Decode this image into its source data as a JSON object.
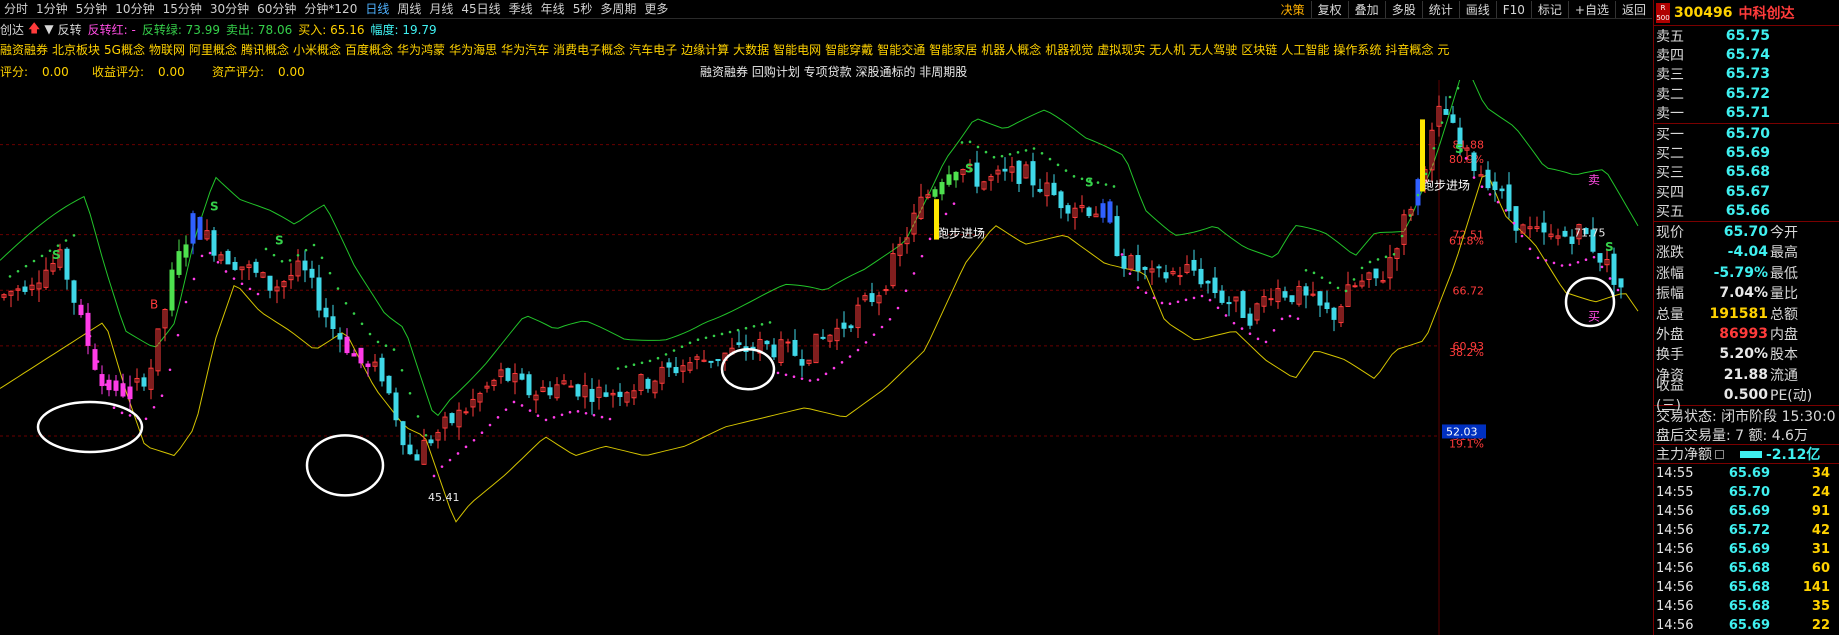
{
  "toolbar": {
    "periods": [
      "分时",
      "1分钟",
      "5分钟",
      "10分钟",
      "15分钟",
      "30分钟",
      "60分钟",
      "分钟*120",
      "日线",
      "周线",
      "月线",
      "45日线",
      "季线",
      "年线",
      "5秒",
      "多周期",
      "更多"
    ],
    "active_period": "日线",
    "tools": [
      "决策",
      "复权",
      "叠加",
      "多股",
      "统计",
      "画线",
      "F10",
      "标记",
      "+自选",
      "返回"
    ]
  },
  "indicator": {
    "name": "创达",
    "up_arrow_icon": "arrow-up-icon",
    "down_arrow_icon": "triangle-down-icon",
    "flip_label": "反转",
    "items": [
      {
        "text": "反转红: -",
        "color": "#ff4de3"
      },
      {
        "text": "反转绿: 73.99",
        "color": "#35d04a"
      },
      {
        "text": "卖出: 78.06",
        "color": "#35d04a"
      },
      {
        "text": "买入: 65.16",
        "color": "#ffd200"
      },
      {
        "text": "幅度: 19.79",
        "color": "#3ff0f0"
      }
    ]
  },
  "sectors": [
    "融资融券",
    "北京板块",
    "5G概念",
    "物联网",
    "阿里概念",
    "腾讯概念",
    "小米概念",
    "百度概念",
    "华为鸿蒙",
    "华为海思",
    "华为汽车",
    "消费电子概念",
    "汽车电子",
    "边缘计算",
    "大数据",
    "智能电网",
    "智能穿戴",
    "智能交通",
    "智能家居",
    "机器人概念",
    "机器视觉",
    "虚拟现实",
    "无人机",
    "无人驾驶",
    "区块链",
    "人工智能",
    "操作系统",
    "抖音概念",
    "元"
  ],
  "scores": [
    {
      "label": "评分:",
      "value": "0.00"
    },
    {
      "label": "收益评分:",
      "value": "0.00"
    },
    {
      "label": "资产评分:",
      "value": "0.00"
    }
  ],
  "note": "融资融券 回购计划 专项贷款 深股通标的 非周期股",
  "chart_data": {
    "type": "candlestick",
    "price_labels": [
      {
        "text": "81.88",
        "value": 81.88,
        "color": "#ff3b3b"
      },
      {
        "text": "80.9%",
        "value": 80.4,
        "color": "#ff3b3b"
      },
      {
        "text": "72.51",
        "value": 72.51,
        "color": "#ff3b3b"
      },
      {
        "text": "61.8%",
        "value": 71.9,
        "color": "#ff3b3b"
      },
      {
        "text": "66.72",
        "value": 66.72,
        "color": "#ff3b3b"
      },
      {
        "text": "60.93",
        "value": 60.93,
        "color": "#ff3b3b"
      },
      {
        "text": "38.2%",
        "value": 60.3,
        "color": "#ff3b3b"
      },
      {
        "text": "51.56",
        "value": 51.56,
        "color": "#ff3b3b"
      },
      {
        "text": "19.1%",
        "value": 50.8,
        "color": "#ff3b3b"
      }
    ],
    "highlight_price": "52.03",
    "highlight_value": 52.03,
    "high_label": "89.47",
    "low_label": "45.41",
    "current_label": "71.75",
    "annotations": [
      {
        "text": "跑步进场",
        "color": "#ffffff"
      },
      {
        "text": "跑步进场",
        "color": "#ffffff"
      },
      {
        "text": "卖",
        "color": "#ff4de3"
      },
      {
        "text": "买",
        "color": "#ff4de3"
      },
      {
        "text": "B",
        "color": "#ff3b3b"
      }
    ],
    "signal_labels": [
      "S"
    ]
  },
  "quote": {
    "badge": "R 500",
    "code": "300496",
    "name": "中科创达",
    "asks": [
      {
        "label": "卖五",
        "price": "65.75"
      },
      {
        "label": "卖四",
        "price": "65.74"
      },
      {
        "label": "卖三",
        "price": "65.73"
      },
      {
        "label": "卖二",
        "price": "65.72"
      },
      {
        "label": "卖一",
        "price": "65.71"
      }
    ],
    "bids": [
      {
        "label": "买一",
        "price": "65.70"
      },
      {
        "label": "买二",
        "price": "65.69"
      },
      {
        "label": "买三",
        "price": "65.68"
      },
      {
        "label": "买四",
        "price": "65.67"
      },
      {
        "label": "买五",
        "price": "65.66"
      }
    ],
    "stats": [
      {
        "label": "现价",
        "value": "65.70",
        "label2": "今开",
        "color": "cyan"
      },
      {
        "label": "涨跌",
        "value": "-4.04",
        "label2": "最高",
        "color": "cyan"
      },
      {
        "label": "涨幅",
        "value": "-5.79%",
        "label2": "最低",
        "color": "cyan"
      },
      {
        "label": "振幅",
        "value": "7.04%",
        "label2": "量比",
        "color": "white"
      },
      {
        "label": "总量",
        "value": "191581",
        "label2": "总额",
        "color": "yellow"
      },
      {
        "label": "外盘",
        "value": "86993",
        "label2": "内盘",
        "color": "red"
      },
      {
        "label": "换手",
        "value": "5.20%",
        "label2": "股本",
        "color": "white"
      },
      {
        "label": "净资",
        "value": "21.88",
        "label2": "流通",
        "color": "white"
      },
      {
        "label": "收益(三)",
        "value": "0.500",
        "label2": "PE(动)",
        "color": "white"
      }
    ],
    "trade_state": "交易状态: 闭市阶段 15:30:0",
    "after_hours": "盘后交易量: 7  额: 4.6万",
    "main_flow_label": "主力净额",
    "main_flow_value": "-2.12亿",
    "ticks": [
      {
        "time": "14:55",
        "price": "65.69",
        "vol": "34"
      },
      {
        "time": "14:55",
        "price": "65.70",
        "vol": "24"
      },
      {
        "time": "14:56",
        "price": "65.69",
        "vol": "91"
      },
      {
        "time": "14:56",
        "price": "65.72",
        "vol": "42"
      },
      {
        "time": "14:56",
        "price": "65.69",
        "vol": "31"
      },
      {
        "time": "14:56",
        "price": "65.68",
        "vol": "60"
      },
      {
        "time": "14:56",
        "price": "65.68",
        "vol": "141"
      },
      {
        "time": "14:56",
        "price": "65.68",
        "vol": "35"
      },
      {
        "time": "14:56",
        "price": "65.69",
        "vol": "22"
      },
      {
        "time": "14:56",
        "price": "65.68",
        "vol": "127"
      }
    ]
  }
}
